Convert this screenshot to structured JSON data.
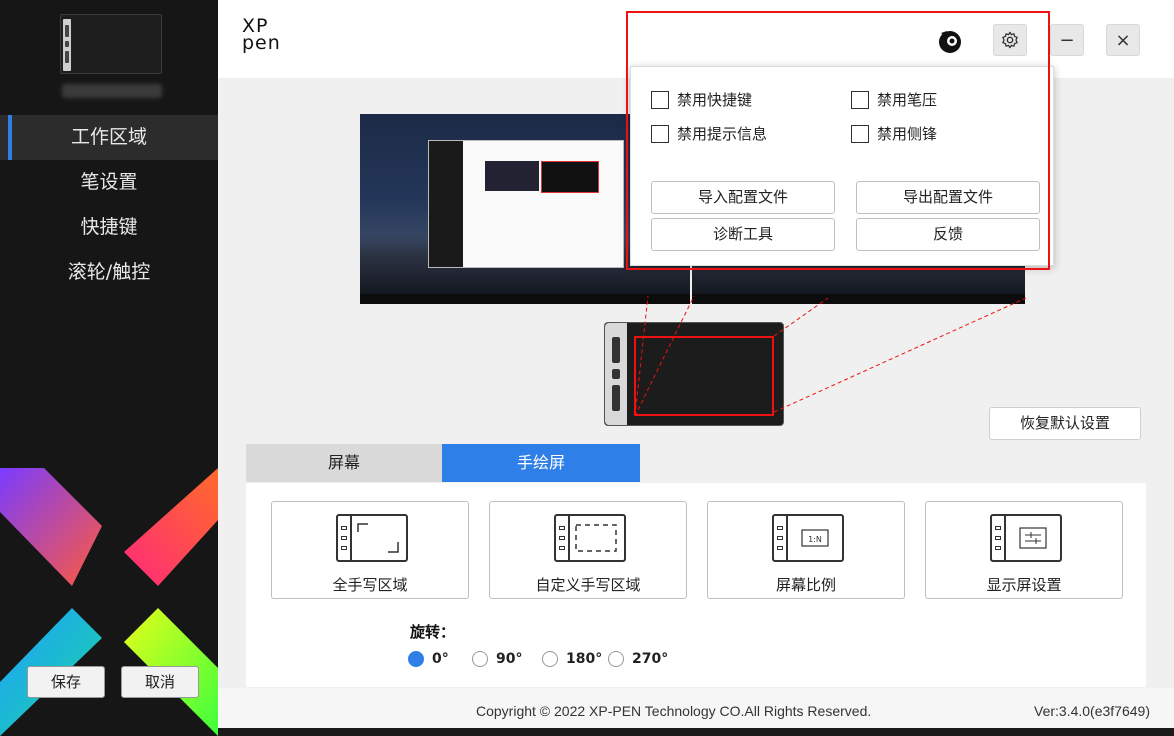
{
  "sidebar": {
    "nav": [
      "工作区域",
      "笔设置",
      "快捷键",
      "滚轮/触控"
    ],
    "active_index": 0,
    "save_label": "保存",
    "cancel_label": "取消"
  },
  "header": {
    "logo_line1": "XP",
    "logo_line2": "pen",
    "minimize_label": "−",
    "close_label": "×"
  },
  "settings_menu": {
    "checkboxes": [
      {
        "label": "禁用快捷键",
        "checked": false
      },
      {
        "label": "禁用笔压",
        "checked": false
      },
      {
        "label": "禁用提示信息",
        "checked": false
      },
      {
        "label": "禁用侧锋",
        "checked": false
      }
    ],
    "buttons": [
      "导入配置文件",
      "导出配置文件",
      "诊断工具",
      "反馈"
    ]
  },
  "work_area": {
    "restore_default_label": "恢复默认设置",
    "tabs": [
      "屏幕",
      "手绘屏"
    ],
    "active_tab": 1,
    "modes": [
      "全手写区域",
      "自定义手写区域",
      "屏幕比例",
      "显示屏设置"
    ],
    "rotation_label": "旋转：",
    "rotation_options": [
      "0°",
      "90°",
      "180°",
      "270°"
    ],
    "rotation_selected": 0
  },
  "footer": {
    "copyright": "Copyright © 2022  XP-PEN Technology CO.All Rights Reserved.",
    "version": "Ver:3.4.0(e3f7649)"
  },
  "colors": {
    "accent": "#2f7fe8",
    "highlight": "#ee1111",
    "sidebar_bg": "#161616"
  }
}
